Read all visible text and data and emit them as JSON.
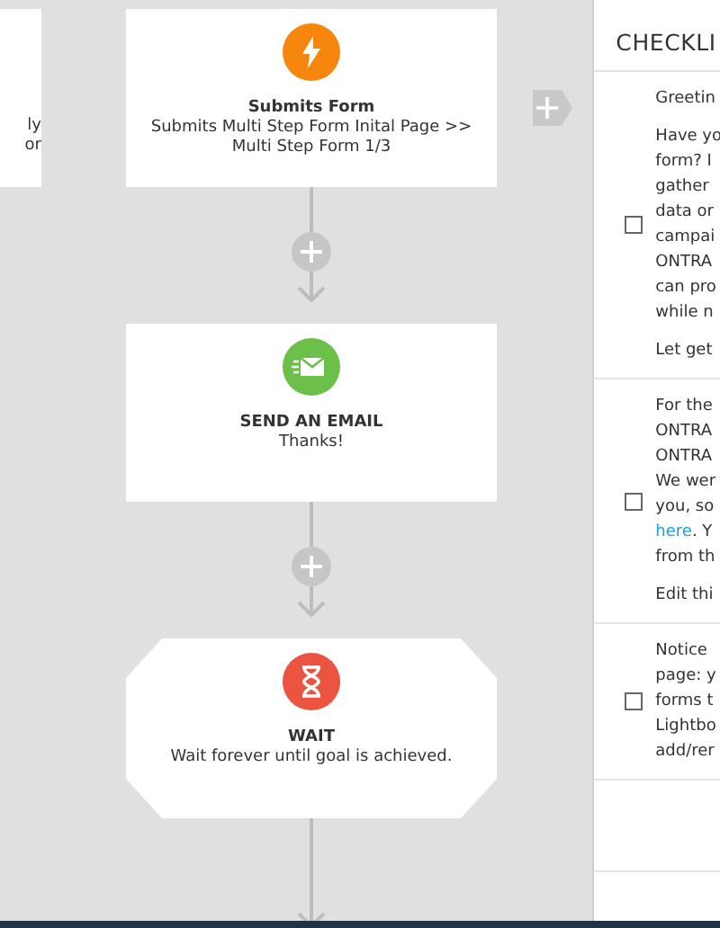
{
  "partial_card": {
    "lines": [
      "ly",
      "or"
    ]
  },
  "nodes": [
    {
      "kind": "trigger",
      "title": "Submits Form",
      "description": "Submits Multi Step Form Inital Page >> Multi Step Form 1/3"
    },
    {
      "kind": "email",
      "title": "SEND AN EMAIL",
      "description": "Thanks!"
    },
    {
      "kind": "wait",
      "title": "WAIT",
      "description": "Wait forever until goal is achieved."
    }
  ],
  "checklist": {
    "title": "CHECKLI",
    "items": [
      {
        "checked": false,
        "blocks": [
          [
            "Greetin"
          ],
          [
            "Have yo",
            "form? I",
            "gather",
            "data or",
            "campai",
            "ONTRA",
            "can pro",
            "while n"
          ],
          [
            "Let get"
          ]
        ]
      },
      {
        "checked": false,
        "blocks": [
          [
            "For the",
            "ONTRA",
            "ONTRA",
            "We wer",
            "you, so",
            "**here**. Y",
            "from th"
          ],
          [
            "Edit thi"
          ]
        ]
      },
      {
        "checked": false,
        "blocks": [
          [
            "Notice",
            "page: y",
            "forms t",
            "Lightbo",
            "add/rer"
          ]
        ]
      }
    ]
  }
}
